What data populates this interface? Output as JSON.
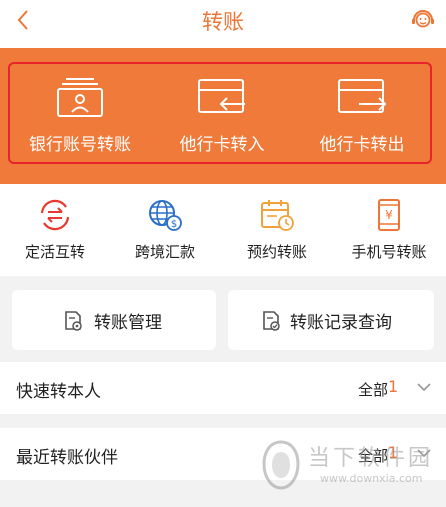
{
  "header": {
    "title": "转账",
    "back_icon": "chevron-left-icon",
    "service_icon": "customer-service-icon"
  },
  "banner": {
    "items": [
      {
        "label": "银行账号转账",
        "icon": "account-card-icon"
      },
      {
        "label": "他行卡转入",
        "icon": "card-transfer-in-icon"
      },
      {
        "label": "他行卡转出",
        "icon": "card-transfer-out-icon"
      }
    ]
  },
  "functions": {
    "items": [
      {
        "label": "定活互转",
        "icon": "exchange-icon"
      },
      {
        "label": "跨境汇款",
        "icon": "globe-dollar-icon"
      },
      {
        "label": "预约转账",
        "icon": "calendar-clock-icon"
      },
      {
        "label": "手机号转账",
        "icon": "phone-yen-icon"
      }
    ]
  },
  "cards": {
    "manage": {
      "label": "转账管理",
      "icon": "doc-gear-icon"
    },
    "records": {
      "label": "转账记录查询",
      "icon": "doc-check-icon"
    }
  },
  "lists": {
    "quick": {
      "label": "快速转本人",
      "filter": "全部",
      "count": "1"
    },
    "recent": {
      "label": "最近转账伙伴",
      "filter": "全部",
      "count": "1"
    }
  },
  "watermark": {
    "text": "当下软件园",
    "url": "www.downxia.com"
  },
  "colors": {
    "accent": "#ee7536",
    "banner": "#ef7a39",
    "highlight_border": "#e8242a"
  }
}
